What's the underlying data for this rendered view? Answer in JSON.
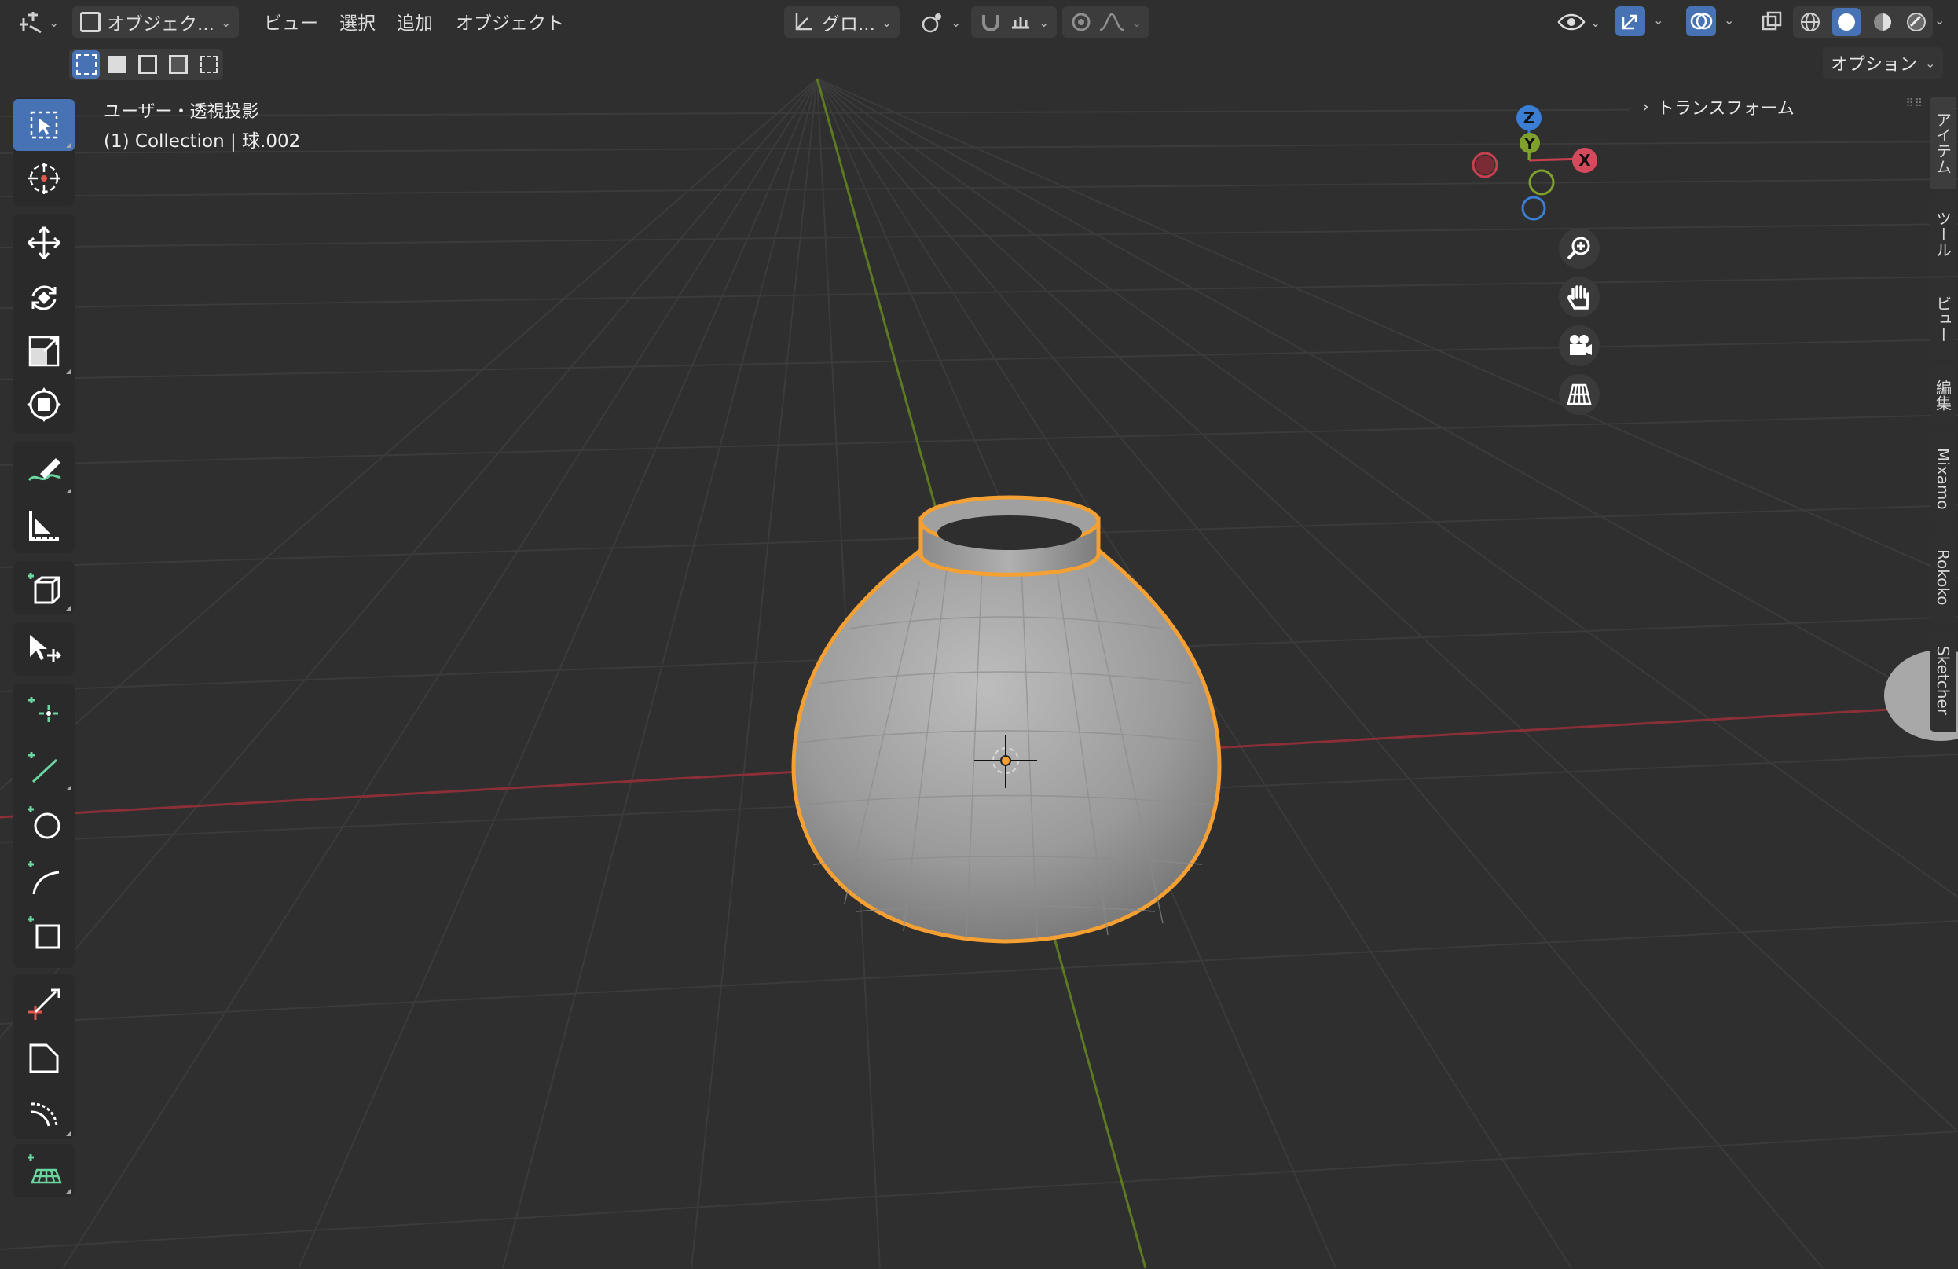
{
  "header": {
    "mode_label": "オブジェク...",
    "menus": [
      "ビュー",
      "選択",
      "追加",
      "オブジェクト"
    ],
    "transform_orientation": "グロ...",
    "options_label": "オプション"
  },
  "viewport": {
    "view_name": "ユーザー・透視投影",
    "collection_info": "(1) Collection | 球.002"
  },
  "sidebar": {
    "panel_title": "トランスフォーム",
    "tabs": [
      "アイテム",
      "ツール",
      "ビュー",
      "編集",
      "Mixamo",
      "Rokoko",
      "Sketcher"
    ]
  },
  "gizmo": {
    "x": "X",
    "y": "Y",
    "z": "Z"
  },
  "colors": {
    "accent": "#4772b3",
    "selection_outline": "#f5a032",
    "x_axis": "#c8404e",
    "y_axis": "#7fa12c",
    "z_axis": "#3a7fd4",
    "add_tool_plus": "#6ad6a0"
  },
  "icons": {
    "tools": [
      "select-box-icon",
      "cursor-icon",
      "move-icon",
      "rotate-icon",
      "scale-icon",
      "transform-icon",
      "annotate-icon",
      "measure-icon",
      "add-cube-icon",
      "selection-to-active-icon",
      "add-point-icon",
      "add-line-icon",
      "add-circle-icon",
      "add-arc-icon",
      "add-rectangle-icon",
      "knife-icon",
      "bevel-icon",
      "spin-icon",
      "add-grid-icon"
    ]
  }
}
